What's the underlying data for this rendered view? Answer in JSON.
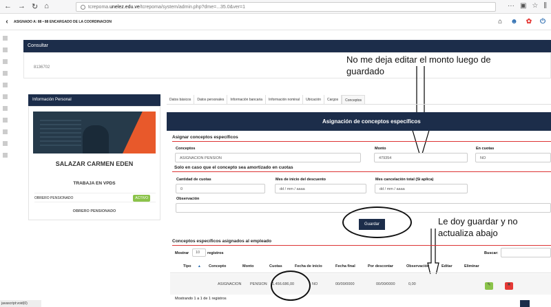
{
  "browser": {
    "url_prefix": "tcrepoma.",
    "url_domain": "unelez.edu.ve",
    "url_suffix": "/tcrepoma/system/admin.php?dme=...35.0&ver=1"
  },
  "appbar": {
    "title": "ASIGNADO A: 88 • 88 ENCARGADO DE LA COORDINACION"
  },
  "consultar": {
    "title": "Consultar",
    "value": "8136702"
  },
  "annotations": {
    "top": "No me deja editar el monto luego de guardado",
    "right": "Le doy guardar y no actualiza abajo"
  },
  "profile": {
    "header": "Información Personal",
    "name": "SALAZAR CARMEN EDEN",
    "works": "TRABAJA EN VPDS",
    "row_label": "OBRERO PENSIONADO",
    "badge": "ACTIVO",
    "role": "OBRERO PENSIONADO"
  },
  "tabs": [
    "Datos básicos",
    "Datos personales",
    "Información bancaria",
    "Información nominal",
    "Ubicación",
    "Cargos",
    "Conceptos"
  ],
  "section": {
    "title": "Asignación de conceptos específicos",
    "assign_title": "Asignar conceptos específicos",
    "concept_label": "Conceptos",
    "concept_value": "ASIGNACION   PENSION",
    "amount_label": "Monto",
    "amount_value": "479354",
    "installments_label": "En cuotas",
    "installments_value": "NO",
    "amortized_title": "Solo en caso que el concepto sea amortizado en cuotas",
    "qty_label": "Cantidad de cuotas",
    "qty_value": "0",
    "start_label": "Mes de inicio del descuento",
    "start_value": "dd / mm / aaaa",
    "end_label": "Mes cancelación total (Si aplica)",
    "end_value": "dd / mm / aaaa",
    "obs_label": "Observación",
    "save_button": "Guardar",
    "assigned_title": "Conceptos específicos asignados al empleado",
    "show_label": "Mostrar",
    "show_value": "10",
    "records_label": "registros",
    "search_label": "Buscar:"
  },
  "table": {
    "headers": [
      "Tipo",
      "Concepto",
      "Monto",
      "Cuotas",
      "Fecha de inicio",
      "Fecha final",
      "Por descontar",
      "Observación",
      "Editar",
      "Eliminar"
    ],
    "row": [
      "ASIGNACION",
      "PENSION",
      "1.456.686,00",
      "NO",
      "00/00/0000",
      "00/00/0000",
      "0,00"
    ],
    "footer": "Mostrando 1 a 1 de 1 registros"
  },
  "statusbar": "javascript:void(0)"
}
